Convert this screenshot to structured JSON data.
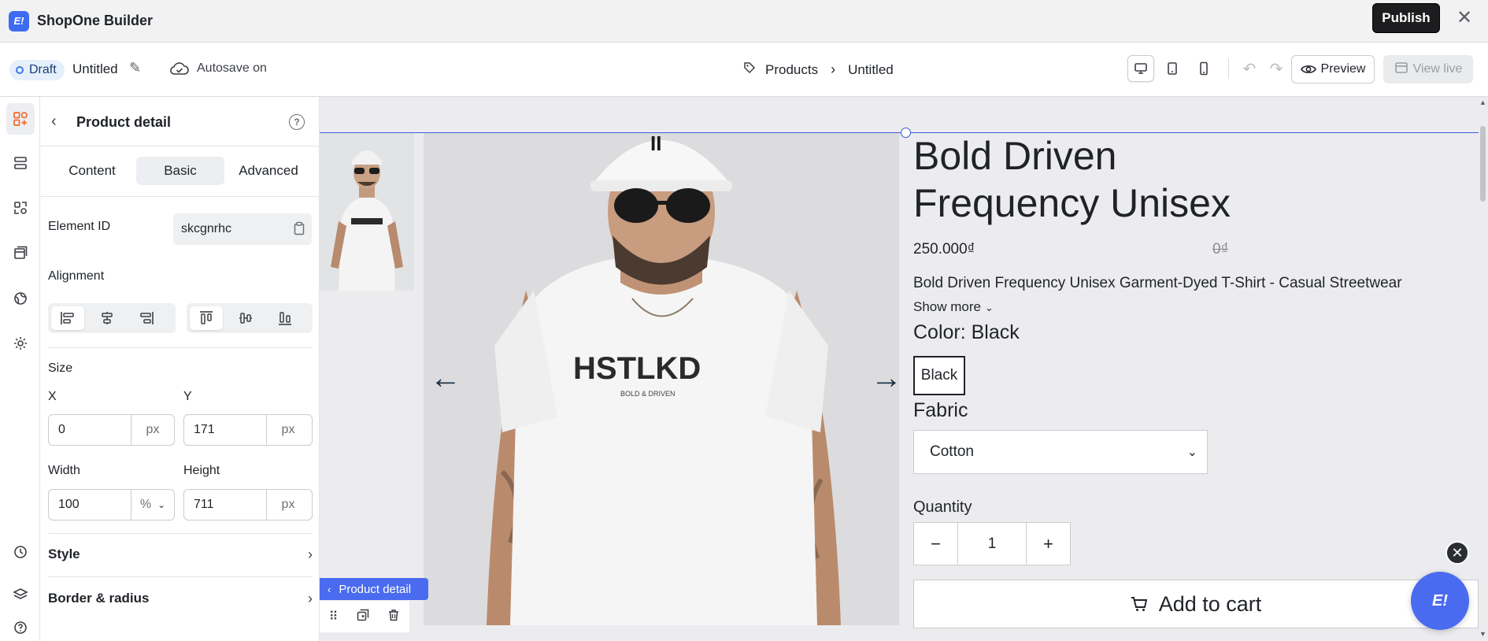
{
  "app": {
    "title": "ShopOne Builder",
    "logo_text": "E!"
  },
  "topbar": {
    "publish_label": "Publish",
    "close_glyph": "✕"
  },
  "subbar": {
    "status": "Draft",
    "doc_title": "Untitled",
    "autosave": "Autosave on",
    "breadcrumb": [
      "Products",
      "Untitled"
    ],
    "preview_label": "Preview",
    "view_live_label": "View live"
  },
  "panel": {
    "title": "Product detail",
    "tabs": [
      "Content",
      "Basic",
      "Advanced"
    ],
    "active_tab": "Basic",
    "element_id_label": "Element ID",
    "element_id_value": "skcgnrhc",
    "alignment_label": "Alignment",
    "size_label": "Size",
    "x_label": "X",
    "x_value": "0",
    "x_unit": "px",
    "y_label": "Y",
    "y_value": "171",
    "y_unit": "px",
    "width_label": "Width",
    "width_value": "100",
    "width_unit": "%",
    "height_label": "Height",
    "height_value": "711",
    "height_unit": "px",
    "sections": [
      "Style",
      "Border & radius"
    ]
  },
  "canvas": {
    "selection_tag": "Product detail",
    "product": {
      "title": "Bold Driven Frequency Unisex",
      "price": "250.000₫",
      "compare_price": "0₫",
      "description": "Bold Driven Frequency Unisex Garment-Dyed T-Shirt - Casual Streetwear",
      "show_more": "Show more",
      "color_label": "Color: Black",
      "color_option": "Black",
      "fabric_label": "Fabric",
      "fabric_value": "Cotton",
      "quantity_label": "Quantity",
      "quantity_value": "1",
      "add_to_cart": "Add to cart",
      "shirt_print": "HSTLKD",
      "shirt_sub": "BOLD & DRIVEN"
    }
  },
  "colors": {
    "accent": "#4a6bf0",
    "brand_orange": "#f06a2a",
    "publish_bg": "#1d1d1f"
  }
}
